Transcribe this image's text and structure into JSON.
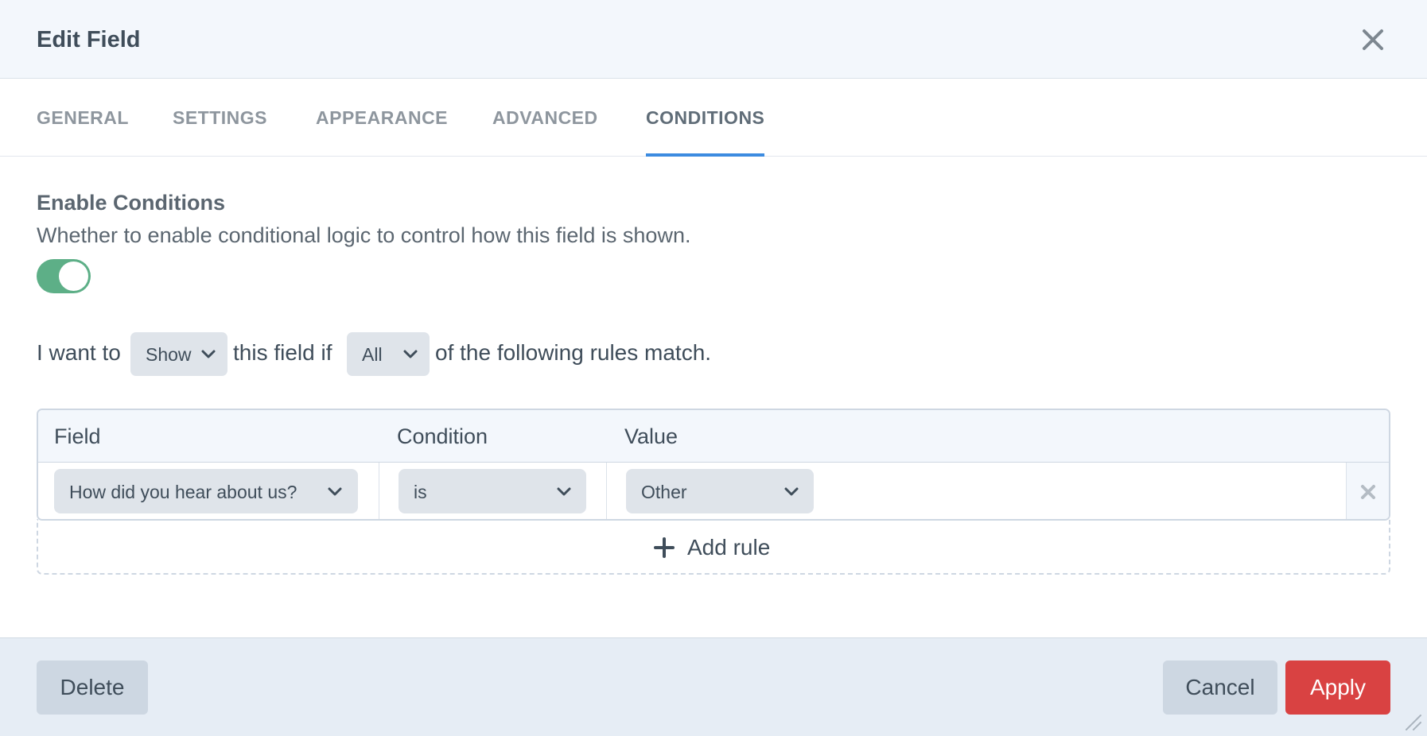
{
  "modal": {
    "title": "Edit Field"
  },
  "tabs": [
    {
      "label": "GENERAL",
      "active": false
    },
    {
      "label": "SETTINGS",
      "active": false
    },
    {
      "label": "APPEARANCE",
      "active": false
    },
    {
      "label": "ADVANCED",
      "active": false
    },
    {
      "label": "CONDITIONS",
      "active": true
    }
  ],
  "conditions": {
    "heading": "Enable Conditions",
    "description": "Whether to enable conditional logic to control how this field is shown.",
    "enabled": true,
    "sentence": {
      "prefix": "I want to",
      "action_value": "Show",
      "middle": "this field if",
      "match_value": "All",
      "suffix": "of the following rules match."
    },
    "table": {
      "headers": [
        "Field",
        "Condition",
        "Value"
      ],
      "rows": [
        {
          "field": "How did you hear about us?",
          "condition": "is",
          "value": "Other"
        }
      ]
    },
    "add_rule_label": "Add rule"
  },
  "footer": {
    "delete_label": "Delete",
    "cancel_label": "Cancel",
    "apply_label": "Apply"
  },
  "colors": {
    "accent": "#3c8be0",
    "toggle_on": "#5daf87",
    "apply": "#d94242"
  },
  "icons": {
    "close": "close-icon",
    "chevron": "chevron-down-icon",
    "remove": "remove-rule-icon",
    "add": "plus-icon",
    "resize": "resize-handle-icon"
  }
}
